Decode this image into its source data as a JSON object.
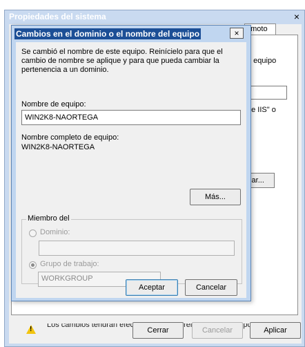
{
  "outer_window": {
    "title": "Propiedades del sistema",
    "close_glyph": "×",
    "tab_label": "emoto",
    "text_line1": "u equipo",
    "text_line2": "de IIS\" o",
    "change_button": "biar...",
    "warning_text": "Los cambios tendrán efecto después de reiniciar este equipo.",
    "buttons": {
      "close": "Cerrar",
      "cancel": "Cancelar",
      "apply": "Aplicar"
    }
  },
  "dialog": {
    "title": "Cambios en el dominio o el nombre del equipo",
    "close_glyph": "×",
    "message": "Se cambió el nombre de este equipo. Reinícielo para que el cambio de nombre se aplique y para que pueda cambiar la pertenencia a un dominio.",
    "computer_name_label": "Nombre de equipo:",
    "computer_name_value": "WIN2K8-NAORTEGA",
    "full_name_label": "Nombre completo de equipo:",
    "full_name_value": "WIN2K8-NAORTEGA",
    "more_button": "Más...",
    "member_of": {
      "legend": "Miembro del",
      "domain_label": "Dominio:",
      "domain_value": "",
      "workgroup_label": "Grupo de trabajo:",
      "workgroup_value": "WORKGROUP",
      "selected": "workgroup"
    },
    "ok_button": "Aceptar",
    "cancel_button": "Cancelar"
  },
  "colors": {
    "title_bar": "#c9daf0",
    "dialog_title_highlight": "#1c4f96",
    "warning": "#f2c40f"
  },
  "icons": {
    "warning": "warning-icon",
    "close": "close-icon"
  }
}
